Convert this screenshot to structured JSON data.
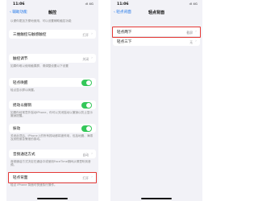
{
  "left_screen": {
    "status_time": "11:06",
    "status_signal": "ıll 4G",
    "back_label": "‹ 辅助功能",
    "title": "触控",
    "top_note": "以便你更加方便地使用，可以设置辅助触控功能",
    "row_triple_tap": {
      "label": "三维触控与触感触控",
      "value": "打开"
    },
    "row_touch_adjust": {
      "label": "触控调节",
      "value": "关闭"
    },
    "touch_adjust_note": "如果你难以使用触摸屏，请调整设置以下设置",
    "row_tap_wake": {
      "label": "轻点唤醒",
      "state": "on"
    },
    "tap_wake_note": "轻点显示屏以唤醒。",
    "row_shake_undo": {
      "label": "摇动以撤销",
      "state": "on"
    },
    "shake_undo_note": "如果你经常意外摇动iPhone，你可以关闭摇动以撤销以防止显示撤销提醒。",
    "row_vibration": {
      "label": "振动",
      "state": "on"
    },
    "vibration_note": "关闭此项后，iPhone上的所有振动都将被停用，包括地震、海啸及其他紧急警报的振动。",
    "row_call_audio": {
      "label": "音频通话方式",
      "value": "自动"
    },
    "call_audio_note": "音频通话方式决定在通话中或使用FaceTime期间从哪里听到音频。",
    "row_back_tap": {
      "label": "轻点背面",
      "value": "打开"
    },
    "back_tap_note": "轻点 iPhone 背面可快速执行操作。"
  },
  "right_screen": {
    "status_time": "11:06",
    "status_signal": "ıll 4G",
    "back_label": "‹ 轻点背面",
    "title": "轻点背面",
    "items": [
      {
        "label": "轻点两下",
        "value": "截屏"
      },
      {
        "label": "轻点三下",
        "value": "无"
      }
    ]
  },
  "colors": {
    "accent": "#1a73e8",
    "toggle_on": "#34c759",
    "highlight": "#e53935",
    "background": "#f2f2f7"
  }
}
